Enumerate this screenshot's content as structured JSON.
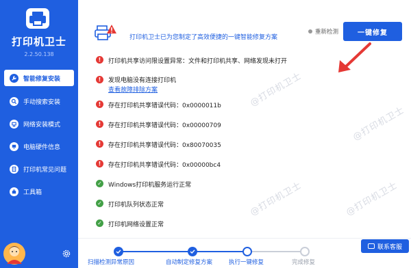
{
  "window": {
    "minimize": "—",
    "close": "✕"
  },
  "app": {
    "title": "打印机卫士",
    "version": "2.2.50.138"
  },
  "sidebar": {
    "items": [
      {
        "label": "智能修复安装",
        "icon": "wrench-icon",
        "active": true
      },
      {
        "label": "手动搜索安装",
        "icon": "search-icon",
        "active": false
      },
      {
        "label": "网络安装模式",
        "icon": "network-icon",
        "active": false
      },
      {
        "label": "电脑硬件信息",
        "icon": "computer-icon",
        "active": false
      },
      {
        "label": "打印机常见问题",
        "icon": "help-icon",
        "active": false
      },
      {
        "label": "工具箱",
        "icon": "toolbox-icon",
        "active": false
      }
    ]
  },
  "header": {
    "message": "打印机卫士已为您制定了高效便捷的一键智能修复方案",
    "rescan_label": "重新检测",
    "fix_button_label": "一键修复"
  },
  "results": [
    {
      "status": "error",
      "text": "打印机共享访问限设置异常：文件和打印机共享、网络发现未打开"
    },
    {
      "status": "error",
      "text": "发现电脑没有连接打印机",
      "link": "查看故障排除方案"
    },
    {
      "status": "error",
      "text": "存在打印机共享错误代码：0x0000011b"
    },
    {
      "status": "error",
      "text": "存在打印机共享错误代码：0x00000709"
    },
    {
      "status": "error",
      "text": "存在打印机共享错误代码：0x80070035"
    },
    {
      "status": "error",
      "text": "存在打印机共享错误代码：0x00000bc4"
    },
    {
      "status": "ok",
      "text": "Windows打印机服务运行正常"
    },
    {
      "status": "ok",
      "text": "打印机队列状态正常"
    },
    {
      "status": "ok",
      "text": "打印机网络设置正常"
    }
  ],
  "steps": [
    {
      "label": "扫描检测异常原因",
      "state": "done"
    },
    {
      "label": "自动制定修复方案",
      "state": "done"
    },
    {
      "label": "执行一键修复",
      "state": "current"
    },
    {
      "label": "完成修复",
      "state": "todo"
    }
  ],
  "contact_label": "联系客服",
  "watermark_text": "@打印机卫士",
  "colors": {
    "primary": "#1f5fe0",
    "error": "#e53935",
    "ok": "#43a047",
    "arrow": "#e53935"
  }
}
